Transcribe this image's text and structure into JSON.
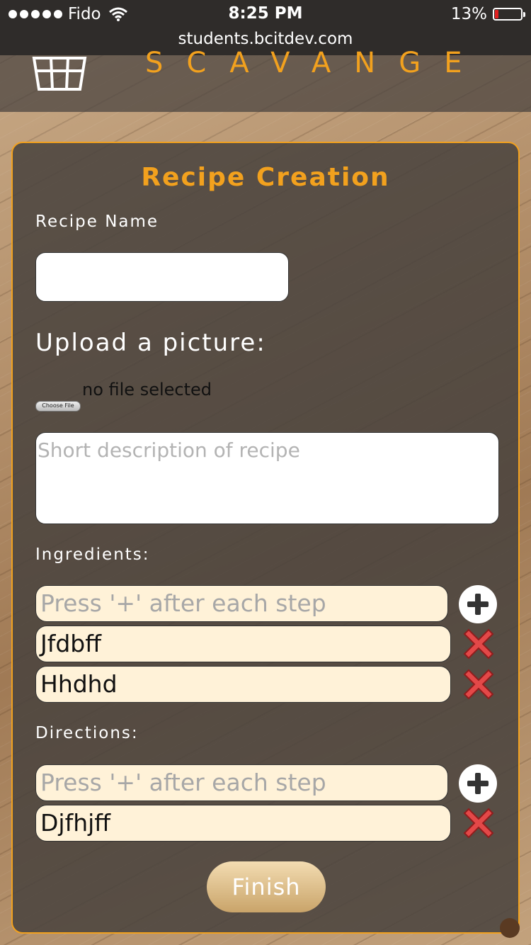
{
  "status_bar": {
    "carrier": "Fido",
    "time": "8:25 PM",
    "battery_percent": "13%",
    "battery_level": 0.13,
    "url": "students.bcitdev.com"
  },
  "header": {
    "brand": "SCAVANGE",
    "accent_color": "#f2a11e"
  },
  "form": {
    "title": "Recipe Creation",
    "recipe_name_label": "Recipe Name",
    "recipe_name_value": "",
    "upload_label": "Upload a picture:",
    "choose_file_label": "Choose File",
    "file_status": "no file selected",
    "description_placeholder": "Short description of recipe",
    "ingredients_label": "Ingredients:",
    "ingredients_placeholder": "Press '+' after each step",
    "ingredients": [
      "Jfdbff",
      "Hhdhd"
    ],
    "directions_label": "Directions:",
    "directions_placeholder": "Press '+' after each step",
    "directions": [
      "Djfhjff"
    ],
    "finish_label": "Finish"
  }
}
